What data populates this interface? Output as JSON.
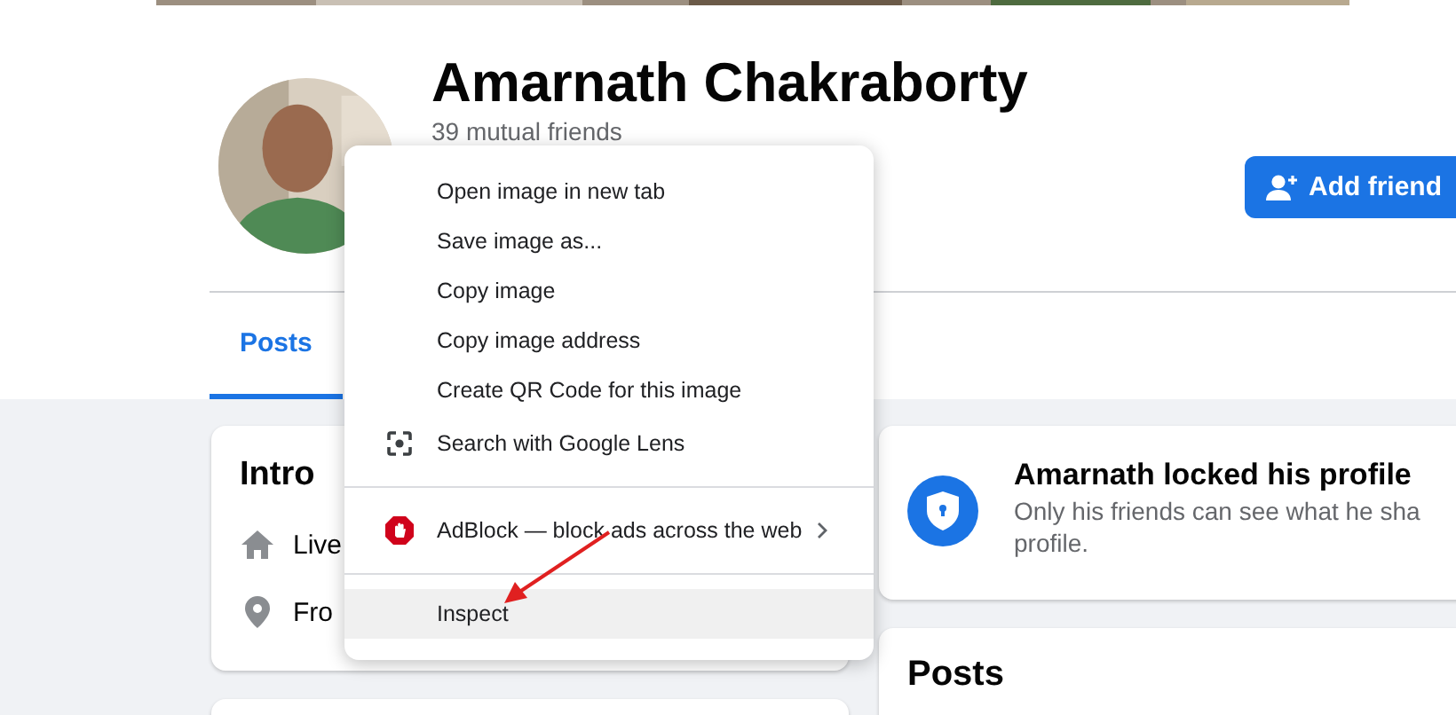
{
  "profile": {
    "name": "Amarnath Chakraborty",
    "mutual_friends": "39 mutual friends",
    "add_friend_button": "Add friend"
  },
  "tabs": [
    {
      "label": "Posts",
      "selected": true
    }
  ],
  "intro": {
    "title": "Intro",
    "items": [
      {
        "kind": "home",
        "text": "Live"
      },
      {
        "kind": "location",
        "text": "Fro"
      }
    ]
  },
  "locked_notice": {
    "title": "Amarnath locked his profile",
    "lines": [
      "Only his friends can see what he sha",
      "profile."
    ]
  },
  "posts_card": {
    "title": "Posts"
  },
  "context_menu": {
    "groups": [
      {
        "items": [
          {
            "kind": "plain",
            "label": "Open image in new tab",
            "highlighted": false
          },
          {
            "kind": "plain",
            "label": "Save image as...",
            "highlighted": false
          },
          {
            "kind": "plain",
            "label": "Copy image",
            "highlighted": false
          },
          {
            "kind": "plain",
            "label": "Copy image address",
            "highlighted": false
          },
          {
            "kind": "plain",
            "label": "Create QR Code for this image",
            "highlighted": false
          },
          {
            "kind": "lens",
            "label": "Search with Google Lens",
            "highlighted": false
          }
        ]
      },
      {
        "items": [
          {
            "kind": "adblock",
            "label": "AdBlock — block ads across the web",
            "highlighted": false
          }
        ]
      },
      {
        "items": [
          {
            "kind": "plain",
            "label": "Inspect",
            "highlighted": true
          }
        ]
      }
    ]
  }
}
